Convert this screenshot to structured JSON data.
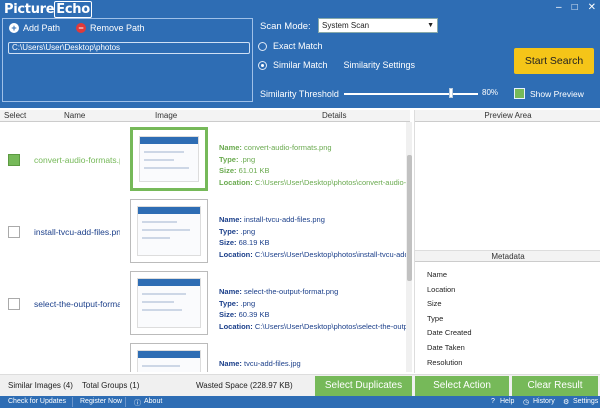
{
  "app": {
    "logo_main": "Picture",
    "logo_accent": "Echo",
    "window_controls": [
      "–",
      "□",
      "✕"
    ]
  },
  "path_panel": {
    "add_label": "Add Path",
    "remove_label": "Remove Path",
    "paths": [
      "C:\\Users\\User\\Desktop\\photos"
    ]
  },
  "scan": {
    "mode_label": "Scan Mode:",
    "mode_value": "System Scan",
    "exact_match": "Exact Match",
    "similar_match": "Similar Match",
    "similarity_settings": "Similarity Settings",
    "threshold_label": "Similarity Threshold",
    "threshold_value": "80%",
    "threshold_fraction": 0.8,
    "start_search": "Start Search",
    "show_preview": "Show Preview"
  },
  "table": {
    "headers": {
      "select": "Select",
      "name": "Name",
      "image": "Image",
      "details": "Details"
    },
    "rows": [
      {
        "name": "convert-audio-formats.p",
        "selected": true,
        "d_name": "convert-audio-formats.png",
        "d_type": ".png",
        "d_size": "61.01 KB",
        "d_location": "C:\\Users\\User\\Desktop\\photos\\convert-audio-"
      },
      {
        "name": "install-tvcu-add-files.png",
        "selected": false,
        "d_name": "install-tvcu-add-files.png",
        "d_type": ".png",
        "d_size": "68.19 KB",
        "d_location": "C:\\Users\\User\\Desktop\\photos\\install-tvcu-add-"
      },
      {
        "name": "select-the-output-forma",
        "selected": false,
        "d_name": "select-the-output-format.png",
        "d_type": ".png",
        "d_size": "60.39 KB",
        "d_location": "C:\\Users\\User\\Desktop\\photos\\select-the-outp"
      },
      {
        "name": "",
        "selected": false,
        "d_name": "tvcu-add-files.jpg",
        "d_type": "",
        "d_size": "",
        "d_location": ""
      }
    ],
    "labels": {
      "name": "Name:",
      "type": "Type:",
      "size": "Size:",
      "location": "Location:"
    }
  },
  "right": {
    "preview_area": "Preview Area",
    "metadata": "Metadata",
    "fields": [
      "Name",
      "Location",
      "Size",
      "Type",
      "Date Created",
      "Date Taken",
      "Resolution"
    ]
  },
  "status": {
    "similar_images": "Similar Images (4)",
    "total_groups": "Total Groups (1)",
    "wasted_space": "Wasted Space (228.97 KB)",
    "select_duplicates": "Select Duplicates",
    "select_action": "Select Action",
    "clear_result": "Clear Result"
  },
  "footer": {
    "check_updates": "Check for Updates",
    "register_now": "Register Now",
    "about": "About",
    "help": "Help",
    "history": "History",
    "settings": "Settings"
  },
  "colors": {
    "brand_blue": "#2e6db4",
    "accent_green": "#76b959",
    "start_yellow": "#f5c518"
  }
}
